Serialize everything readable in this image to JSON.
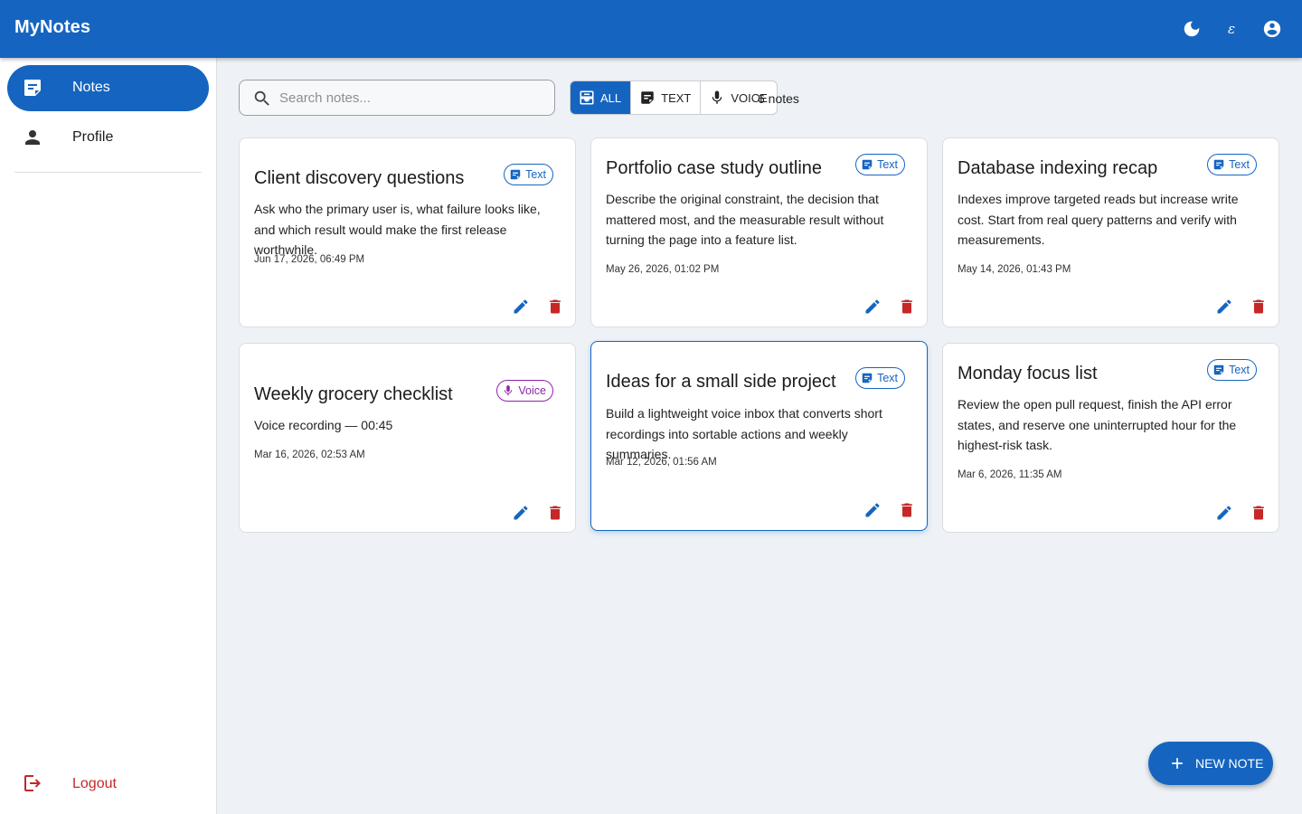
{
  "app": {
    "title": "MyNotes"
  },
  "topbar": {
    "icons": [
      "dark-mode-icon",
      "language-icon",
      "account-icon"
    ],
    "language_glyph": "ɛ"
  },
  "sidebar": {
    "items": [
      {
        "label": "Notes",
        "icon": "notes-icon",
        "active": true
      },
      {
        "label": "Profile",
        "icon": "person-icon",
        "active": false
      }
    ],
    "logout_label": "Logout"
  },
  "search": {
    "placeholder": "Search notes...",
    "value": ""
  },
  "filters": [
    {
      "label": "ALL",
      "icon": "inbox-icon",
      "active": true
    },
    {
      "label": "TEXT",
      "icon": "text-note-icon",
      "active": false
    },
    {
      "label": "VOICE",
      "icon": "mic-icon",
      "active": false
    }
  ],
  "count_label": "6 notes",
  "notes": [
    {
      "title": "Client discovery questions",
      "type": "Text",
      "body": "Ask who the primary user is, what failure looks like, and which result would make the first release worthwhile.",
      "date": "Jun 17, 2026, 06:49 PM"
    },
    {
      "title": "Portfolio case study outline",
      "type": "Text",
      "body": "Describe the original constraint, the decision that mattered most, and the measurable result without turning the page into a feature list.",
      "date": "May 26, 2026, 01:02 PM"
    },
    {
      "title": "Database indexing recap",
      "type": "Text",
      "body": "Indexes improve targeted reads but increase write cost. Start from real query patterns and verify with measurements.",
      "date": "May 14, 2026, 01:43 PM"
    },
    {
      "title": "Weekly grocery checklist",
      "type": "Voice",
      "body": "Voice recording — 00:45",
      "date": "Mar 16, 2026, 02:53 AM"
    },
    {
      "title": "Ideas for a small side project",
      "type": "Text",
      "body": "Build a lightweight voice inbox that converts short recordings into sortable actions and weekly summaries.",
      "date": "Mar 12, 2026, 01:56 AM"
    },
    {
      "title": "Monday focus list",
      "type": "Text",
      "body": "Review the open pull request, finish the API error states, and reserve one uninterrupted hour for the highest-risk task.",
      "date": "Mar 6, 2026, 11:35 AM"
    }
  ],
  "fab": {
    "label": "NEW NOTE"
  },
  "colors": {
    "primary": "#1565c0",
    "danger": "#c62828",
    "voice": "#8e24aa",
    "background": "#eef2f6"
  }
}
